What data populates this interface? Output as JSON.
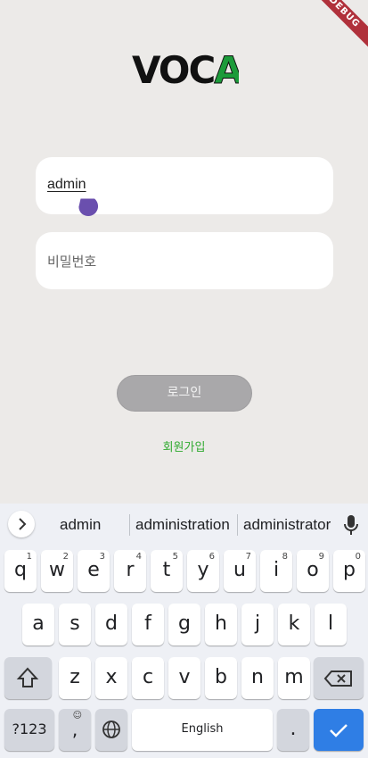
{
  "debug_banner": "DEBUG",
  "logo": {
    "part1": "VOC",
    "part2": "AI"
  },
  "username": {
    "value": "admin"
  },
  "password": {
    "placeholder": "비밀번호"
  },
  "login_button": "로그인",
  "signup_link": "회원가입",
  "keyboard": {
    "suggestions": [
      "admin",
      "administration",
      "administrator"
    ],
    "row1": [
      {
        "k": "q",
        "h": "1"
      },
      {
        "k": "w",
        "h": "2"
      },
      {
        "k": "e",
        "h": "3"
      },
      {
        "k": "r",
        "h": "4"
      },
      {
        "k": "t",
        "h": "5"
      },
      {
        "k": "y",
        "h": "6"
      },
      {
        "k": "u",
        "h": "7"
      },
      {
        "k": "i",
        "h": "8"
      },
      {
        "k": "o",
        "h": "9"
      },
      {
        "k": "p",
        "h": "0"
      }
    ],
    "row2": [
      "a",
      "s",
      "d",
      "f",
      "g",
      "h",
      "j",
      "k",
      "l"
    ],
    "row3": [
      "z",
      "x",
      "c",
      "v",
      "b",
      "n",
      "m"
    ],
    "symbols_key": "?123",
    "comma_key": ",",
    "comma_hint": "☺",
    "space_label": "English",
    "period_key": ".",
    "accent_color": "#2f7ee5"
  }
}
